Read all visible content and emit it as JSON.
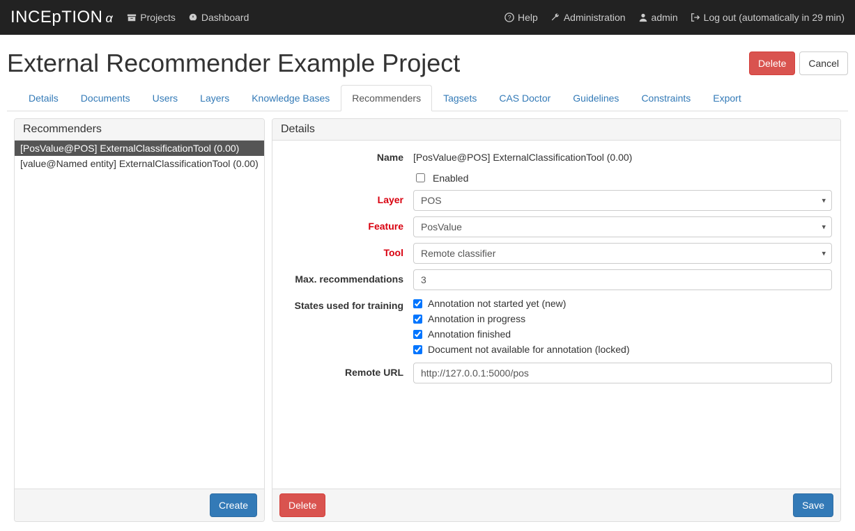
{
  "brand": "INCEpTION",
  "brand_suffix": "α",
  "nav": {
    "projects": "Projects",
    "dashboard": "Dashboard",
    "help": "Help",
    "administration": "Administration",
    "admin": "admin",
    "logout": "Log out (automatically in 29 min)"
  },
  "page_title": "External Recommender Example Project",
  "buttons": {
    "delete": "Delete",
    "cancel": "Cancel",
    "create": "Create",
    "save": "Save"
  },
  "tabs": [
    {
      "label": "Details",
      "active": false
    },
    {
      "label": "Documents",
      "active": false
    },
    {
      "label": "Users",
      "active": false
    },
    {
      "label": "Layers",
      "active": false
    },
    {
      "label": "Knowledge Bases",
      "active": false
    },
    {
      "label": "Recommenders",
      "active": true
    },
    {
      "label": "Tagsets",
      "active": false
    },
    {
      "label": "CAS Doctor",
      "active": false
    },
    {
      "label": "Guidelines",
      "active": false
    },
    {
      "label": "Constraints",
      "active": false
    },
    {
      "label": "Export",
      "active": false
    }
  ],
  "sidebar": {
    "heading": "Recommenders",
    "items": [
      {
        "label": "[PosValue@POS] ExternalClassificationTool (0.00)",
        "selected": true
      },
      {
        "label": "[value@Named entity] ExternalClassificationTool (0.00)",
        "selected": false
      }
    ]
  },
  "details": {
    "heading": "Details",
    "labels": {
      "name": "Name",
      "enabled": "Enabled",
      "layer": "Layer",
      "feature": "Feature",
      "tool": "Tool",
      "max_rec": "Max. recommendations",
      "states": "States used for training",
      "remote_url": "Remote URL"
    },
    "values": {
      "name": "[PosValue@POS] ExternalClassificationTool (0.00)",
      "layer": "POS",
      "feature": "PosValue",
      "tool": "Remote classifier",
      "max_rec": "3",
      "remote_url": "http://127.0.0.1:5000/pos"
    },
    "states": [
      "Annotation not started yet (new)",
      "Annotation in progress",
      "Annotation finished",
      "Document not available for annotation (locked)"
    ]
  }
}
